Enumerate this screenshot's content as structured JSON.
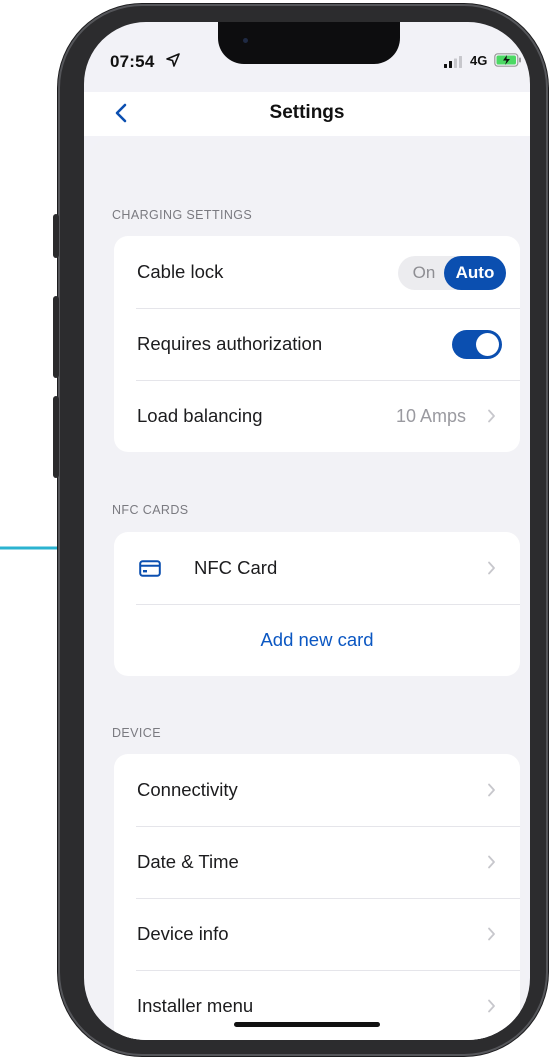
{
  "status": {
    "time": "07:54",
    "network": "4G",
    "icons": [
      "location-arrow-icon",
      "signal-icon",
      "battery-charging-icon"
    ]
  },
  "nav": {
    "title": "Settings",
    "back_icon": "chevron-left-icon"
  },
  "charging": {
    "header": "CHARGING SETTINGS",
    "cable_lock": {
      "label": "Cable lock",
      "options": [
        "On",
        "Auto"
      ],
      "selected": "Auto"
    },
    "authorization": {
      "label": "Requires authorization",
      "enabled": true
    },
    "load_balancing": {
      "label": "Load balancing",
      "value": "10 Amps"
    }
  },
  "nfc": {
    "header": "NFC CARDS",
    "card": {
      "label": "NFC Card",
      "icon": "card-icon"
    },
    "add_label": "Add new card"
  },
  "device": {
    "header": "DEVICE",
    "items": [
      {
        "label": "Connectivity"
      },
      {
        "label": "Date & Time"
      },
      {
        "label": "Device info"
      },
      {
        "label": "Installer menu"
      }
    ]
  },
  "colors": {
    "accent": "#0b4fb0",
    "link": "#0b57c2",
    "annotation_arrow": "#2bb3d0",
    "background": "#f2f2f7"
  }
}
